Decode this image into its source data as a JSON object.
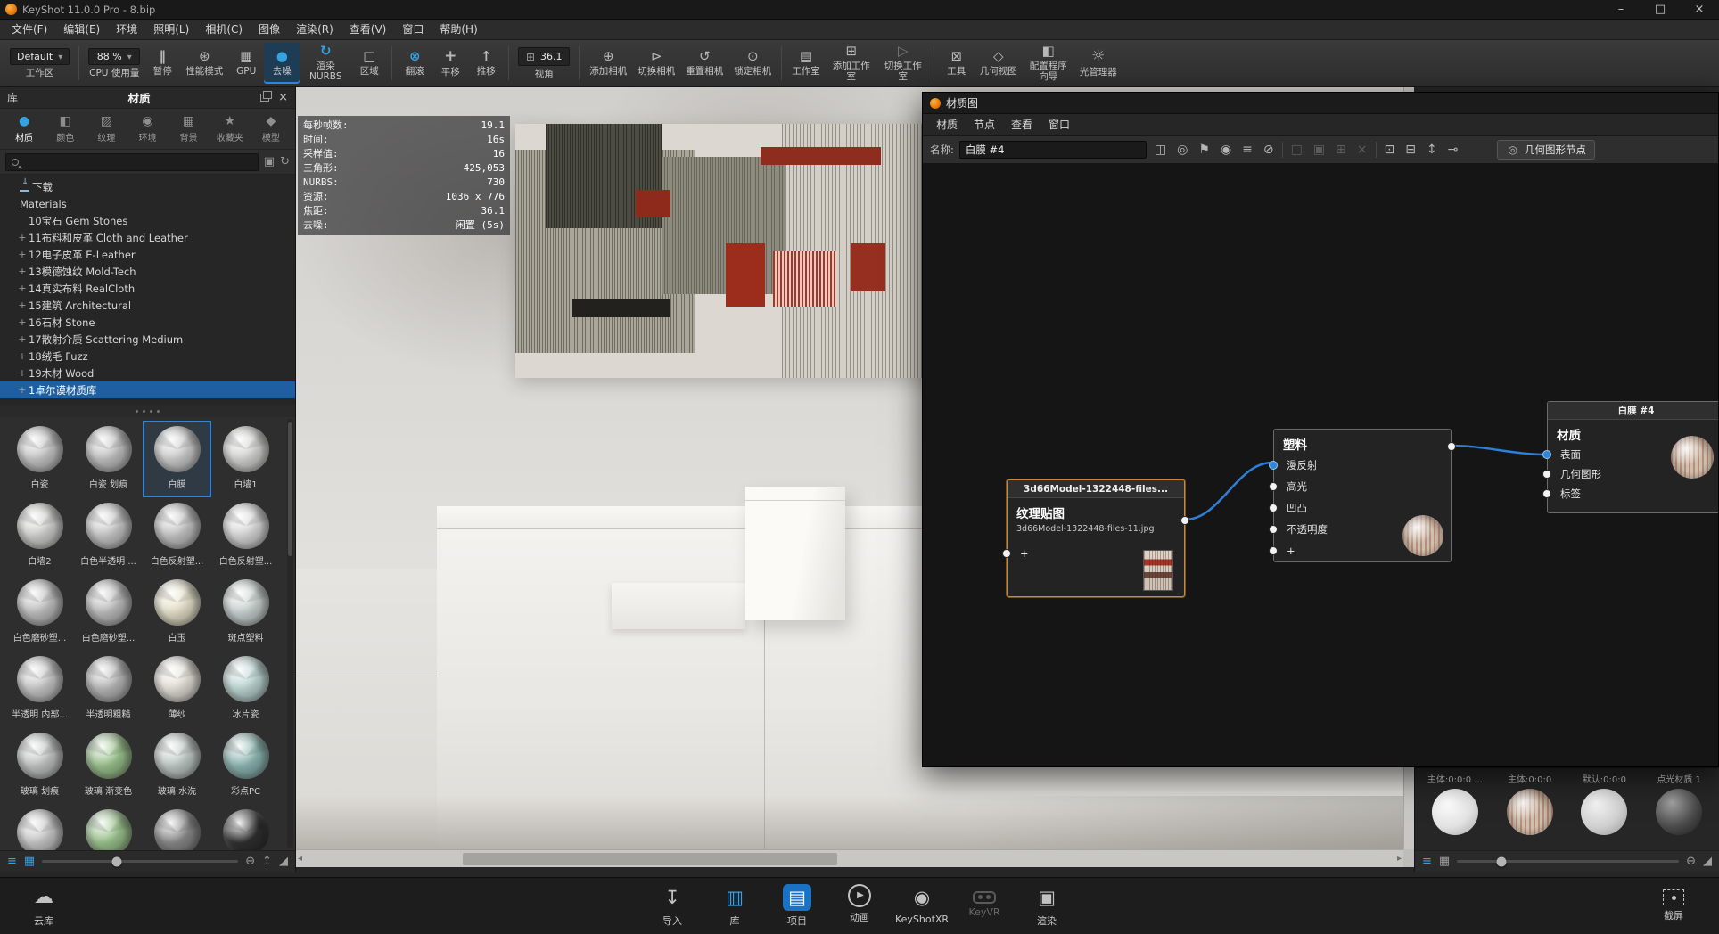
{
  "titlebar": {
    "title": "KeyShot 11.0.0 Pro  - 8.bip",
    "minimize": "–",
    "maximize": "□",
    "close": "×"
  },
  "menubar": {
    "items": [
      "文件(F)",
      "编辑(E)",
      "环境",
      "照明(L)",
      "相机(C)",
      "图像",
      "渲染(R)",
      "查看(V)",
      "窗口",
      "帮助(H)"
    ]
  },
  "toolbar": {
    "workspace": {
      "value": "Default",
      "label": "工作区"
    },
    "cpu": {
      "value": "88 %",
      "label": "CPU 使用量"
    },
    "pause": "暂停",
    "perf": "性能模式",
    "gpu": "GPU",
    "denoise": "去噪",
    "nurbs": "渲染NURBS",
    "region": "区域",
    "tumble": "翻滚",
    "pan": "平移",
    "dolly": "推移",
    "fov": {
      "value": "36.1",
      "label": "视角"
    },
    "add_cam": "添加相机",
    "switch_cam": "切换相机",
    "reset_cam": "重置相机",
    "lock_cam": "锁定相机",
    "studio": "工作室",
    "add_studio": "添加工作室",
    "switch_studio": "切换工作室",
    "tools": "工具",
    "geo_view": "几何视图",
    "wizard": "配置程序向导",
    "light_mgr": "光管理器"
  },
  "library": {
    "panel_title": "库",
    "section_title": "材质",
    "tabs": [
      {
        "label": "材质",
        "icon": "material-sphere-icon",
        "active": true
      },
      {
        "label": "颜色",
        "icon": "color-icon"
      },
      {
        "label": "纹理",
        "icon": "texture-icon"
      },
      {
        "label": "环境",
        "icon": "environment-icon"
      },
      {
        "label": "背景",
        "icon": "backplate-icon"
      },
      {
        "label": "收藏夹",
        "icon": "favorites-icon"
      },
      {
        "label": "模型",
        "icon": "model-icon"
      }
    ],
    "tree": [
      {
        "label": "下载",
        "prefix": ""
      },
      {
        "label": "Materials",
        "prefix": ""
      },
      {
        "label": "10宝石 Gem Stones",
        "prefix": ""
      },
      {
        "label": "11布料和皮革 Cloth and Leather",
        "prefix": "+"
      },
      {
        "label": "12电子皮革 E-Leather",
        "prefix": "+"
      },
      {
        "label": "13模德蚀纹 Mold-Tech",
        "prefix": "+"
      },
      {
        "label": "14真实布料 RealCloth",
        "prefix": "+"
      },
      {
        "label": "15建筑 Architectural",
        "prefix": "+"
      },
      {
        "label": "16石材 Stone",
        "prefix": "+"
      },
      {
        "label": "17散射介质 Scattering Medium",
        "prefix": "+"
      },
      {
        "label": "18绒毛 Fuzz",
        "prefix": "+"
      },
      {
        "label": "19木材 Wood",
        "prefix": "+"
      },
      {
        "label": "1卓尔谟材质库",
        "prefix": "+",
        "selected": true
      }
    ],
    "grid": [
      {
        "label": "白瓷",
        "tone": "#c8c8c8"
      },
      {
        "label": "白瓷 划痕",
        "tone": "#c3c3c3"
      },
      {
        "label": "白膜",
        "tone": "#cfcfcf",
        "selected": true
      },
      {
        "label": "白墙1",
        "tone": "#d6d6d4"
      },
      {
        "label": "白墙2",
        "tone": "#d2d2d0"
      },
      {
        "label": "白色半透明 ...",
        "tone": "#c9c9c9"
      },
      {
        "label": "白色反射塑...",
        "tone": "#c6c6c6"
      },
      {
        "label": "白色反射塑...",
        "tone": "#dadada"
      },
      {
        "label": "白色磨砂塑...",
        "tone": "#c2c2c2"
      },
      {
        "label": "白色磨砂塑...",
        "tone": "#bfbfbf"
      },
      {
        "label": "白玉",
        "tone": "#e9e4cd"
      },
      {
        "label": "斑点塑料",
        "tone": "#cdd6d4"
      },
      {
        "label": "半透明 内部...",
        "tone": "#c9c9c9"
      },
      {
        "label": "半透明粗糙",
        "tone": "#b9b9b9"
      },
      {
        "label": "薄纱",
        "tone": "#e6e3da"
      },
      {
        "label": "冰片瓷",
        "tone": "#bfd9d5"
      },
      {
        "label": "玻璃 划痕",
        "tone": "#c4c6c6"
      },
      {
        "label": "玻璃 渐变色",
        "tone": "#9cc48e"
      },
      {
        "label": "玻璃 水洗",
        "tone": "#c2ccc9"
      },
      {
        "label": "彩点PC",
        "tone": "#8fb8b4"
      },
      {
        "label": "",
        "tone": "#c9c9c9"
      },
      {
        "label": "",
        "tone": "#9cc48e"
      },
      {
        "label": "",
        "tone": "#8a8a8a"
      },
      {
        "label": "",
        "tone": "#303030"
      }
    ]
  },
  "stats": {
    "rows": [
      {
        "label": "每秒帧数:",
        "value": "19.1"
      },
      {
        "label": "时间:",
        "value": "16s"
      },
      {
        "label": "采样值:",
        "value": "16"
      },
      {
        "label": "三角形:",
        "value": "425,053"
      },
      {
        "label": "NURBS:",
        "value": "730"
      },
      {
        "label": "资源:",
        "value": "1036 x 776"
      },
      {
        "label": "焦距:",
        "value": "36.1"
      },
      {
        "label": "去噪:",
        "value": "闲置 (5s)"
      }
    ]
  },
  "graph": {
    "window_title": "材质图",
    "menus": [
      "材质",
      "节点",
      "查看",
      "窗口"
    ],
    "name_label": "名称:",
    "name_value": "白膜 #4",
    "geometry_button": "几何图形节点",
    "accent_wire_color": "#2f7fd6",
    "texture_node": {
      "header": "3d66Model-1322448-files...",
      "title": "纹理贴图",
      "subtitle": "3d66Model-1322448-files-11.jpg",
      "add_port": "+"
    },
    "plastic_node": {
      "title": "塑料",
      "inputs": [
        "漫反射",
        "高光",
        "凹凸",
        "不透明度"
      ],
      "add_port": "+"
    },
    "material_node": {
      "header": "白膜 #4",
      "title": "材质",
      "inputs": [
        "表面",
        "几何图形",
        "标签"
      ]
    }
  },
  "bin": {
    "items": [
      {
        "label": "主体:0:0:0 ..."
      },
      {
        "label": "主体:0:0:0"
      },
      {
        "label": "默认:0:0:0"
      },
      {
        "label": "点光材质 1"
      }
    ]
  },
  "dock": {
    "cloud": "云库",
    "items": [
      {
        "label": "导入"
      },
      {
        "label": "库",
        "highlight": true
      },
      {
        "label": "项目",
        "active": true
      },
      {
        "label": "动画"
      },
      {
        "label": "KeyShotXR"
      },
      {
        "label": "KeyVR",
        "disabled": true
      },
      {
        "label": "渲染"
      }
    ],
    "screenshot": "截屏"
  }
}
